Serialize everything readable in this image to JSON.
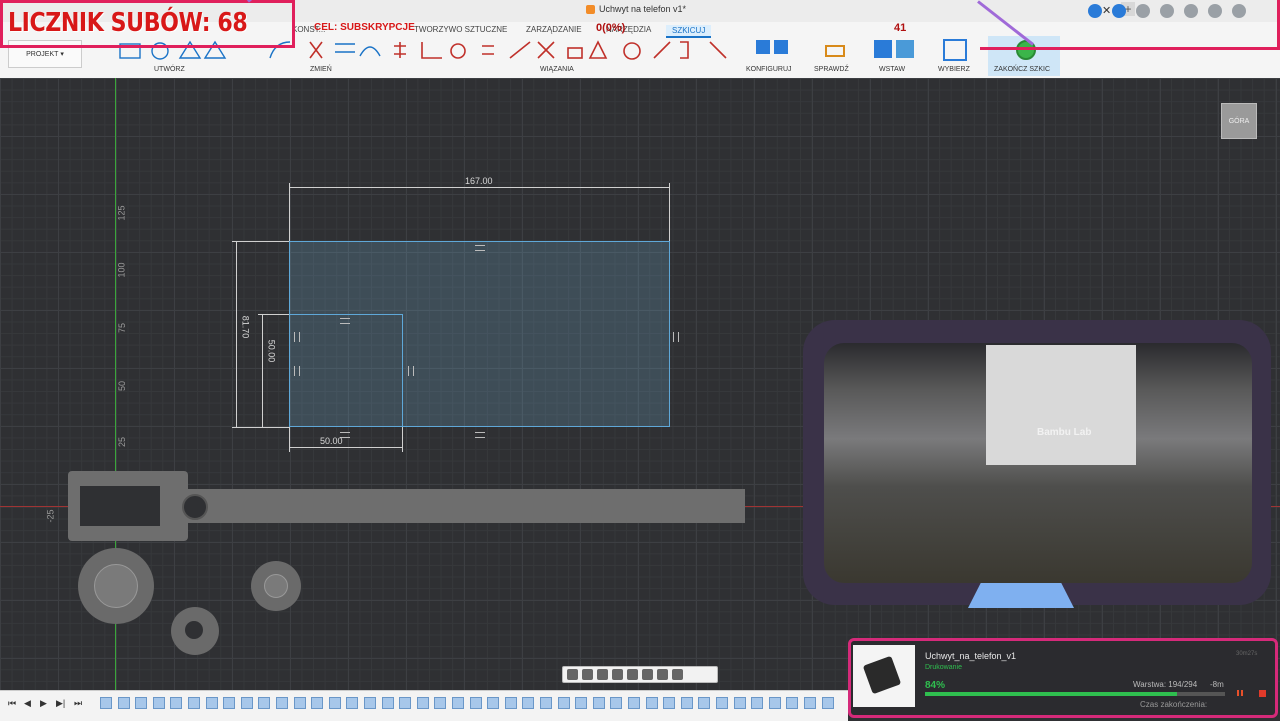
{
  "window": {
    "title": "Uchwyt na telefon v1*"
  },
  "ribbon": {
    "tabs": [
      "KONST...",
      "TWORZYWO SZTUCZNE",
      "ZARZĄDZANIE",
      "NARZĘDZIA",
      "SZKICUJ"
    ],
    "active_tab": "SZKICUJ",
    "projekt_label": "PROJEKT",
    "groups": [
      "UTWÓRZ",
      "ZMIEŃ",
      "WIĄZANIA",
      "KONFIGURUJ",
      "SPRAWDŹ",
      "WSTAW",
      "WYBIERZ",
      "ZAKOŃCZ SZKIC"
    ]
  },
  "overlay": {
    "subs_counter": "LICZNIK SUBÓW: 68",
    "goal_text": "CEL: SUBSKRYPCJE",
    "goal_value": "0(0%)",
    "goal_number": "41"
  },
  "canvas": {
    "axis_labels": [
      "125",
      "100",
      "75",
      "50",
      "25",
      "-25"
    ],
    "dimensions": {
      "width": "167.00",
      "height": "81.70",
      "inner_height": "50.00",
      "inner_width": "50.00"
    },
    "view_cube": "GÓRA"
  },
  "camera": {
    "brand_label": "Bambu Lab"
  },
  "print": {
    "name": "Uchwyt_na_telefon_v1",
    "status": "Drukowanie",
    "percent": "84%",
    "percent_value": 84,
    "layer": "Warstwa: 194/294",
    "time_left": "-8m",
    "end_label": "Czas zakończenia:",
    "corner": "30m27s"
  },
  "colors": {
    "accent": "#1a73c7",
    "overlay_red": "#d81818",
    "overlay_frame": "#e0205c",
    "progress": "#2fbf4f"
  }
}
